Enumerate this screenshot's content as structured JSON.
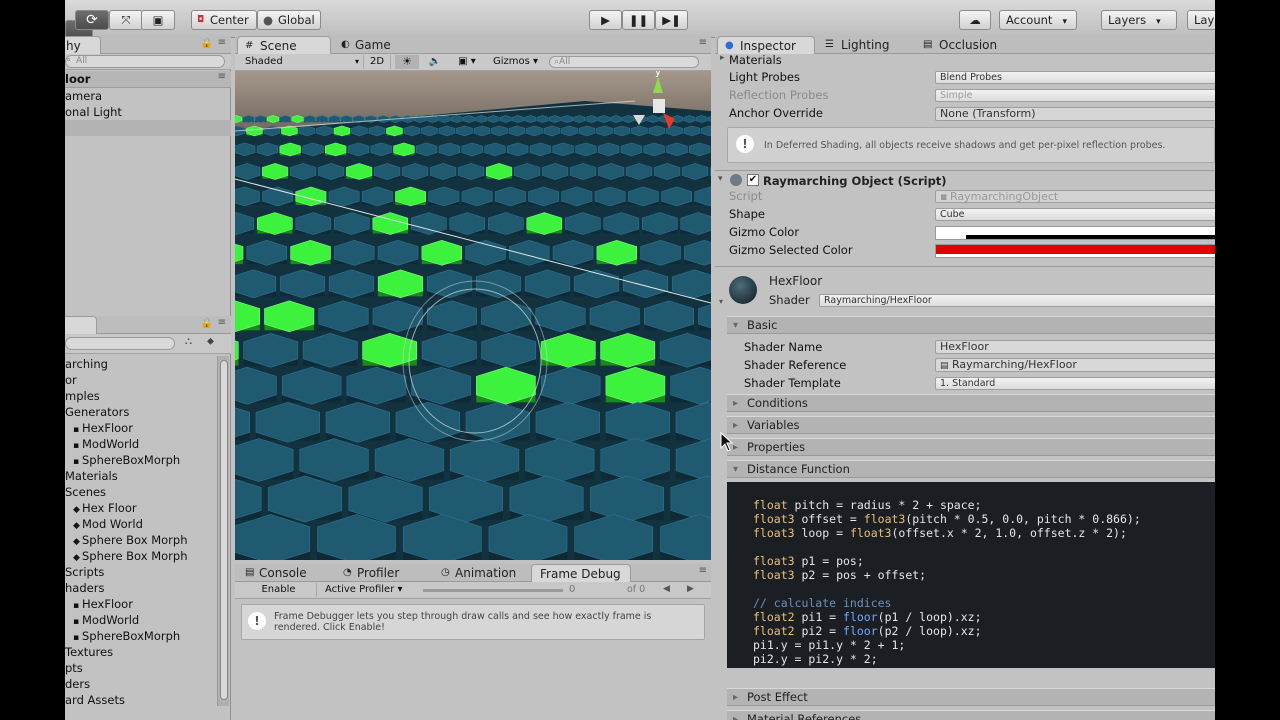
{
  "toolbar": {
    "pivot": "Center",
    "space": "Global",
    "account": "Account",
    "layers": "Layers",
    "layout": "Lay"
  },
  "hierarchy": {
    "tab": "hy",
    "search": "All",
    "scene": "loor",
    "items": [
      "amera",
      "onal Light"
    ]
  },
  "project": {
    "items": [
      "arching",
      "or",
      "mples",
      "Generators",
      "HexFloor",
      "ModWorld",
      "SphereBoxMorph",
      "Materials",
      "Scenes",
      "Hex Floor",
      "Mod World",
      "Sphere Box Morph",
      "Sphere Box Morph",
      "Scripts",
      "haders",
      "HexFloor",
      "ModWorld",
      "SphereBoxMorph",
      "Textures",
      "pts",
      "ders",
      "ard Assets"
    ]
  },
  "scene": {
    "tab_scene": "Scene",
    "tab_game": "Game",
    "shading": "Shaded",
    "mode2d": "2D",
    "gizmos": "Gizmos",
    "search": "All",
    "gizmo_axis": "y"
  },
  "console": {
    "tab_console": "Console",
    "tab_profiler": "Profiler",
    "tab_animation": "Animation",
    "tab_frame": "Frame Debug",
    "enable": "Enable",
    "profiler": "Active Profiler",
    "frame_value": "0",
    "frame_of": "of 0",
    "message": "Frame Debugger lets you step through draw calls and see how exactly frame is rendered. Click Enable!"
  },
  "inspector": {
    "tab_inspector": "Inspector",
    "tab_lighting": "Lighting",
    "tab_occlusion": "Occlusion",
    "materials_label": "Materials",
    "light_probes_label": "Light Probes",
    "light_probes_value": "Blend Probes",
    "reflection_probes_label": "Reflection Probes",
    "reflection_probes_value": "Simple",
    "anchor_label": "Anchor Override",
    "anchor_value": "None (Transform)",
    "info": "In Deferred Shading, all objects receive shadows and get per-pixel reflection probes.",
    "component_title": "Raymarching Object (Script)",
    "script_label": "Script",
    "script_value": "RaymarchingObject",
    "shape_label": "Shape",
    "shape_value": "Cube",
    "gizmo_color_label": "Gizmo Color",
    "gizmo_selected_label": "Gizmo Selected Color",
    "material_name": "HexFloor",
    "shader_label": "Shader",
    "shader_value": "Raymarching/HexFloor",
    "basic": "Basic",
    "shader_name_label": "Shader Name",
    "shader_name_value": "HexFloor",
    "shader_ref_label": "Shader Reference",
    "shader_ref_value": "Raymarching/HexFloor",
    "shader_tmpl_label": "Shader Template",
    "shader_tmpl_value": "1. Standard",
    "conditions": "Conditions",
    "variables": "Variables",
    "properties": "Properties",
    "distance_function": "Distance Function",
    "post_effect": "Post Effect",
    "material_references": "Material References"
  },
  "code": [
    {
      "t": "float",
      "r": " pitch = radius * 2 + space;"
    },
    {
      "t": "float3",
      "r": " offset = ",
      "f": "float3",
      "r2": "(pitch * 0.5, 0.0, pitch * 0.866);"
    },
    {
      "t": "float3",
      "r": " loop = ",
      "f": "float3",
      "r2": "(offset.x * 2, 1.0, offset.z * 2);"
    },
    {
      "t": "",
      "r": ""
    },
    {
      "t": "float3",
      "r": " p1 = pos;"
    },
    {
      "t": "float3",
      "r": " p2 = pos + offset;"
    },
    {
      "t": "",
      "r": ""
    },
    {
      "c": "// calculate indices"
    },
    {
      "t": "float2",
      "r": " pi1 = ",
      "f": "floor",
      "r2": "(p1 / loop).xz;"
    },
    {
      "t": "float2",
      "r": " pi2 = ",
      "f": "floor",
      "r2": "(p2 / loop).xz;"
    },
    {
      "t": "",
      "r": "pi1.y = pi1.y * 2 + 1;"
    },
    {
      "t": "",
      "r": "pi2.y = pi2.y * 2;"
    }
  ],
  "colors": {
    "hex_green": "#3df23d",
    "hex_teal": "#1f5a70",
    "gizmo_red": "#e00000"
  }
}
